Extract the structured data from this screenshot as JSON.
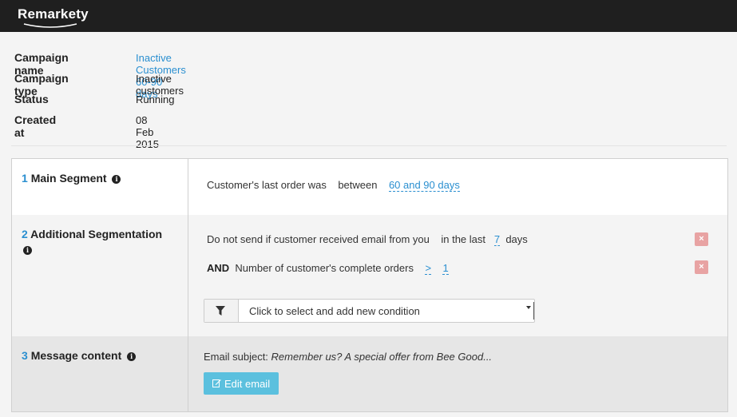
{
  "app": {
    "logo": "Remarkety"
  },
  "campaign": {
    "fields": [
      {
        "label": "Campaign name",
        "value": "Inactive Customers 60-90 days"
      },
      {
        "label": "Campaign type",
        "value": "Inactive customers"
      },
      {
        "label": "Status",
        "value": "Running"
      },
      {
        "label": "Created at",
        "value": "08 Feb 2015"
      }
    ]
  },
  "sections": {
    "main_segment": {
      "number": "1",
      "title": "Main Segment",
      "icon": "info-icon",
      "condition": {
        "text": "Customer's last order was",
        "operator": "between",
        "value": "60 and 90 days"
      }
    },
    "additional": {
      "number": "2",
      "title": "Additional Segmentation",
      "icon": "info-icon",
      "rows": [
        {
          "prefix": "",
          "text": "Do not send if customer received email from you",
          "operator": "in the last",
          "value": "7",
          "suffix": "days",
          "remove": "×"
        },
        {
          "prefix": "AND",
          "text": "Number of customer's complete orders",
          "operator": ">",
          "value": "1",
          "suffix": "",
          "remove": "×"
        }
      ],
      "add_condition_placeholder": "Click to select and add new condition"
    },
    "message": {
      "number": "3",
      "title": "Message content",
      "icon": "info-icon",
      "subject_label": "Email subject:",
      "subject_value": "Remember us? A special offer from Bee Good...",
      "edit_button": "Edit email"
    }
  },
  "colors": {
    "topbar": "#1f1f1f",
    "link": "#2a8fd0",
    "remove": "#e8a3a3",
    "edit_button": "#5bc0de"
  }
}
